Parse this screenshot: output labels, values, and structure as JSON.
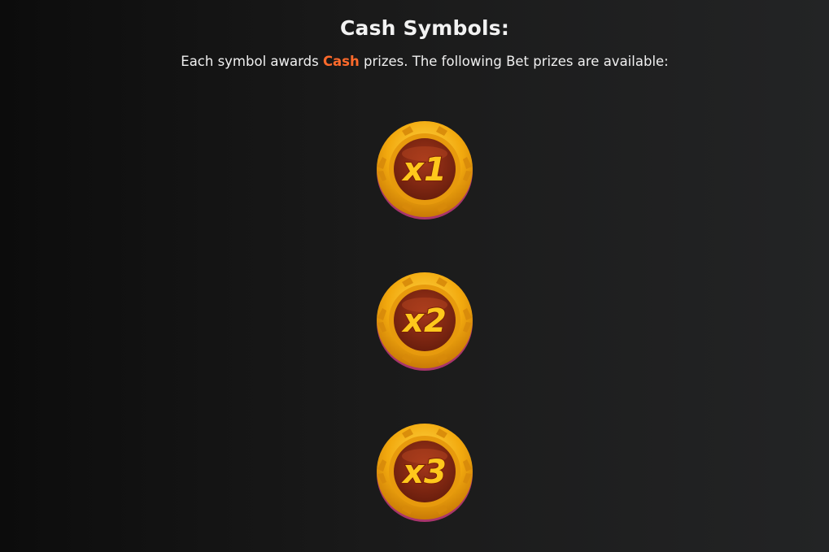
{
  "header": {
    "title": "Cash Symbols:",
    "desc_before": "Each symbol awards ",
    "desc_highlight": "Cash",
    "desc_after": " prizes. The following Bet prizes are available:",
    "highlight_color": "#ff6a2b"
  },
  "symbols": [
    {
      "label": "x1",
      "icon": "cash-coin-icon"
    },
    {
      "label": "x2",
      "icon": "cash-coin-icon"
    },
    {
      "label": "x3",
      "icon": "cash-coin-icon"
    }
  ],
  "colors": {
    "coin_gold": "#f2b012",
    "coin_center": "#8a2a14",
    "coin_text": "#ffc81c",
    "coin_rim_shadow": "#c23a7a"
  }
}
